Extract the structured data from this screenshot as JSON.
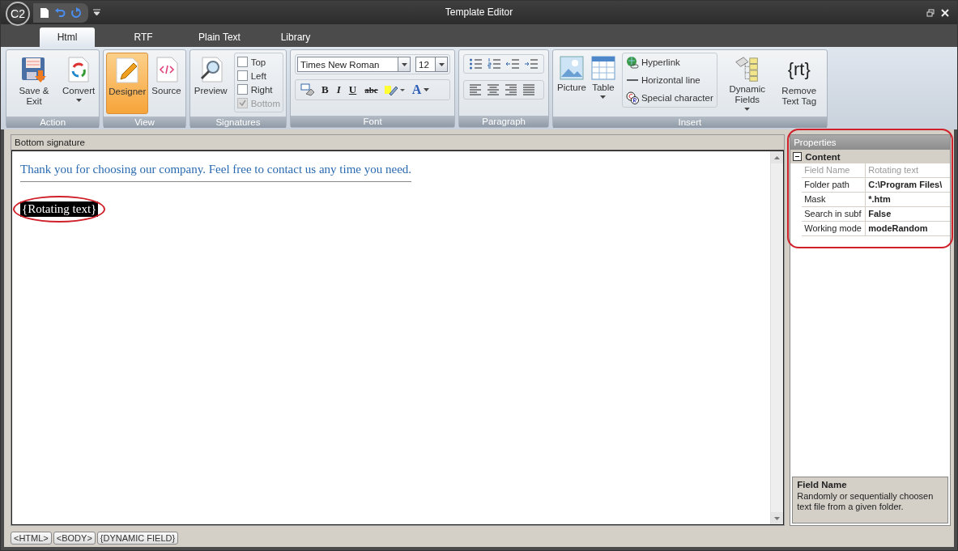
{
  "window": {
    "title": "Template Editor",
    "logo": "C2"
  },
  "tabs": [
    {
      "label": "Html",
      "selected": true
    },
    {
      "label": "RTF",
      "selected": false
    },
    {
      "label": "Plain Text",
      "selected": false
    },
    {
      "label": "Library",
      "selected": false
    }
  ],
  "ribbon": {
    "groups": [
      {
        "label": "Action",
        "items": [
          {
            "kind": "large",
            "label": "Save & Exit",
            "dropdown": false,
            "selected": false
          },
          {
            "kind": "large",
            "label": "Convert",
            "dropdown": true,
            "selected": false
          }
        ]
      },
      {
        "label": "View",
        "items": [
          {
            "kind": "large",
            "label": "Designer",
            "dropdown": false,
            "selected": true
          },
          {
            "kind": "large",
            "label": "Source",
            "dropdown": false,
            "selected": false
          }
        ]
      },
      {
        "label": "Signatures",
        "items": [
          {
            "kind": "large",
            "label": "Preview",
            "dropdown": false,
            "selected": false
          },
          {
            "kind": "checks",
            "checks": [
              {
                "label": "Top",
                "checked": false,
                "disabled": false
              },
              {
                "label": "Left",
                "checked": false,
                "disabled": false
              },
              {
                "label": "Right",
                "checked": false,
                "disabled": false
              },
              {
                "label": "Bottom",
                "checked": true,
                "disabled": true
              }
            ]
          }
        ]
      },
      {
        "label": "Font",
        "items": [
          {
            "kind": "font",
            "font": "Times New Roman",
            "size": "12",
            "format": [
              {
                "kind": "clear"
              },
              {
                "kind": "text",
                "text": "B"
              },
              {
                "kind": "text",
                "text": "I"
              },
              {
                "kind": "text",
                "text": "U"
              },
              {
                "kind": "text",
                "text": "abc"
              },
              {
                "kind": "highlight"
              },
              {
                "kind": "color",
                "text": "A"
              }
            ]
          }
        ]
      },
      {
        "label": "Paragraph",
        "items": [
          {
            "kind": "paragraph"
          }
        ]
      },
      {
        "label": "Insert",
        "items": [
          {
            "kind": "large",
            "label": "Picture",
            "dropdown": false,
            "selected": false
          },
          {
            "kind": "large",
            "label": "Table",
            "dropdown": true,
            "selected": false
          },
          {
            "kind": "small",
            "links": [
              {
                "label": "Hyperlink"
              },
              {
                "label": "Horizontal line"
              },
              {
                "label": "Special character"
              }
            ]
          },
          {
            "kind": "large",
            "label": "Dynamic Fields",
            "dropdown": true,
            "selected": false
          },
          {
            "kind": "large",
            "icon_text": "{rt}",
            "label": "Remove Text Tag",
            "dropdown": false,
            "selected": false
          }
        ]
      }
    ]
  },
  "document": {
    "title": "Bottom signature",
    "text": "Thank you for choosing our company. Feel free to contact us any time you need.",
    "field": "{Rotating text}",
    "field_circled": true
  },
  "properties": {
    "title": "Properties",
    "circled": true,
    "category": "Content",
    "expanded": true,
    "rows": [
      {
        "name": "Field Name",
        "value": "Rotating text",
        "disabled": true
      },
      {
        "name": "Folder path",
        "value": "C:\\Program Files\\",
        "disabled": false
      },
      {
        "name": "Mask",
        "value": "*.htm",
        "disabled": false
      },
      {
        "name": "Search in subf",
        "value": "False",
        "disabled": false
      },
      {
        "name": "Working mode",
        "value": "modeRandom",
        "disabled": false
      }
    ],
    "description_title": "Field Name",
    "description": "Randomly or sequentially choosen text file from a given folder."
  },
  "status_bar": {
    "tags": [
      "<HTML>",
      "<BODY>",
      "{DYNAMIC FIELD}"
    ]
  }
}
